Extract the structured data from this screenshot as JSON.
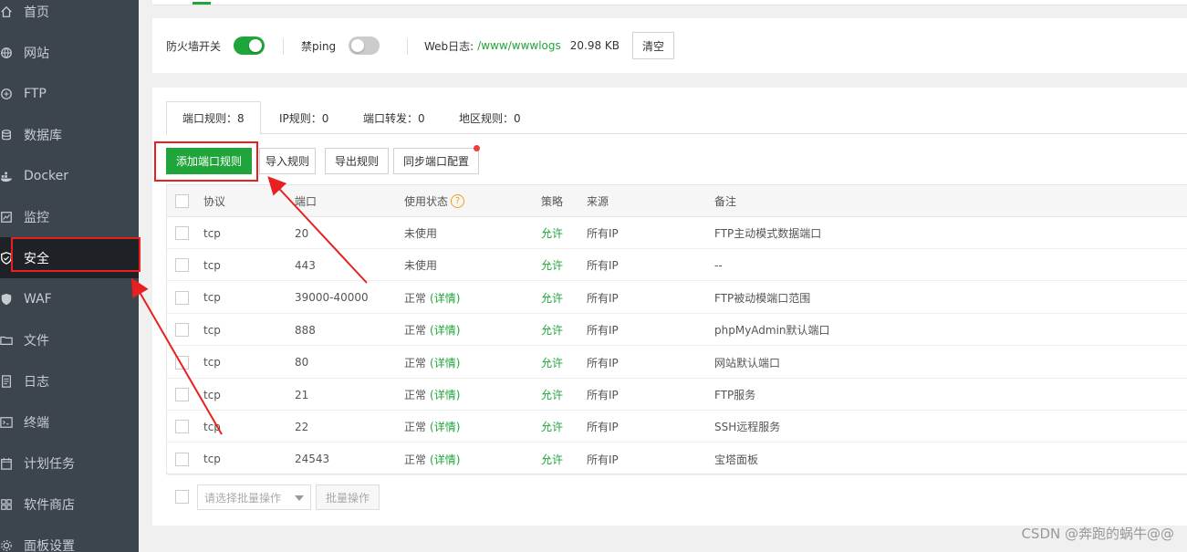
{
  "sidebar": {
    "items": [
      {
        "label": "首页",
        "icon": "home-icon"
      },
      {
        "label": "网站",
        "icon": "globe-icon"
      },
      {
        "label": "FTP",
        "icon": "ftp-icon"
      },
      {
        "label": "数据库",
        "icon": "database-icon"
      },
      {
        "label": "Docker",
        "icon": "docker-icon"
      },
      {
        "label": "监控",
        "icon": "monitor-icon"
      },
      {
        "label": "安全",
        "icon": "shield-icon",
        "active": true
      },
      {
        "label": "WAF",
        "icon": "waf-shield-icon"
      },
      {
        "label": "文件",
        "icon": "folder-icon"
      },
      {
        "label": "日志",
        "icon": "log-icon"
      },
      {
        "label": "终端",
        "icon": "terminal-icon"
      },
      {
        "label": "计划任务",
        "icon": "calendar-icon"
      },
      {
        "label": "软件商店",
        "icon": "grid-icon"
      },
      {
        "label": "面板设置",
        "icon": "settings-icon"
      }
    ]
  },
  "firewall": {
    "switch_label": "防火墙开关",
    "switch_on": true,
    "ping_label": "禁ping",
    "ping_on": false,
    "weblog_label": "Web日志:",
    "weblog_path": "/www/wwwlogs",
    "weblog_size": "20.98 KB",
    "clear_label": "清空"
  },
  "tabs": [
    {
      "label": "端口规则：8",
      "active": true
    },
    {
      "label": "IP规则：0"
    },
    {
      "label": "端口转发：0"
    },
    {
      "label": "地区规则：0"
    }
  ],
  "toolbar": {
    "add_label": "添加端口规则",
    "import_label": "导入规则",
    "export_label": "导出规则",
    "sync_label": "同步端口配置"
  },
  "table": {
    "headers": {
      "protocol": "协议",
      "port": "端口",
      "status": "使用状态",
      "help": "?",
      "policy": "策略",
      "source": "来源",
      "remark": "备注"
    },
    "rows": [
      {
        "protocol": "tcp",
        "port": "20",
        "status": "未使用",
        "detail": "",
        "policy": "允许",
        "source": "所有IP",
        "remark": "FTP主动模式数据端口"
      },
      {
        "protocol": "tcp",
        "port": "443",
        "status": "未使用",
        "detail": "",
        "policy": "允许",
        "source": "所有IP",
        "remark": "--"
      },
      {
        "protocol": "tcp",
        "port": "39000-40000",
        "status": "正常",
        "detail": "(详情)",
        "policy": "允许",
        "source": "所有IP",
        "remark": "FTP被动模端口范围"
      },
      {
        "protocol": "tcp",
        "port": "888",
        "status": "正常",
        "detail": "(详情)",
        "policy": "允许",
        "source": "所有IP",
        "remark": "phpMyAdmin默认端口"
      },
      {
        "protocol": "tcp",
        "port": "80",
        "status": "正常",
        "detail": "(详情)",
        "policy": "允许",
        "source": "所有IP",
        "remark": "网站默认端口"
      },
      {
        "protocol": "tcp",
        "port": "21",
        "status": "正常",
        "detail": "(详情)",
        "policy": "允许",
        "source": "所有IP",
        "remark": "FTP服务"
      },
      {
        "protocol": "tcp",
        "port": "22",
        "status": "正常",
        "detail": "(详情)",
        "policy": "允许",
        "source": "所有IP",
        "remark": "SSH远程服务"
      },
      {
        "protocol": "tcp",
        "port": "24543",
        "status": "正常",
        "detail": "(详情)",
        "policy": "允许",
        "source": "所有IP",
        "remark": "宝塔面板"
      }
    ]
  },
  "batch": {
    "select_placeholder": "请选择批量操作",
    "button_label": "批量操作"
  },
  "watermark": "CSDN @奔跑的蜗牛@@",
  "colors": {
    "accent": "#20a53a",
    "annotation": "#e82020",
    "sidebar_bg": "#3c444d"
  }
}
